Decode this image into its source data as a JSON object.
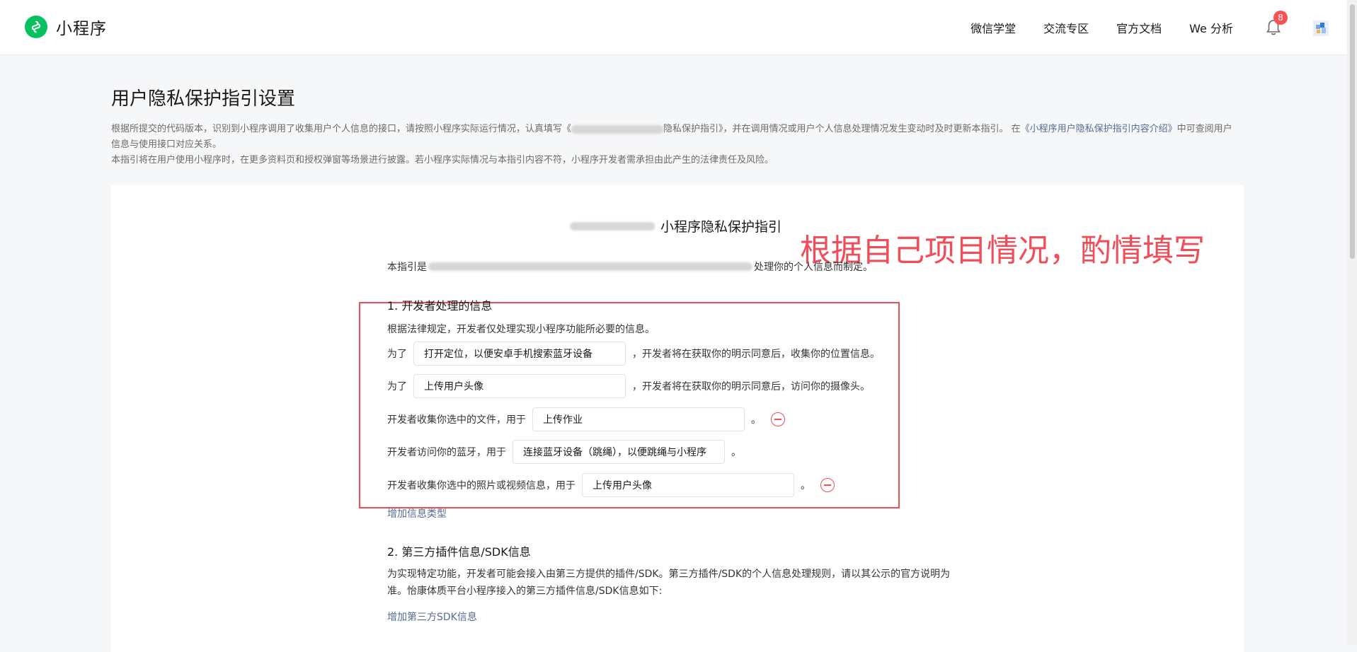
{
  "header": {
    "brand": "小程序",
    "nav": [
      "微信学堂",
      "交流专区",
      "官方文档",
      "We 分析"
    ],
    "notification_count": "8",
    "icons": [
      "mini-program-logo-icon",
      "bell-icon",
      "avatar"
    ]
  },
  "page": {
    "title": "用户隐私保护指引设置",
    "intro_1a": "根据所提交的代码版本，识别到小程序调用了收集用户个人信息的接口，请按照小程序实际运行情况，认真填写《",
    "intro_1b": "隐私保护指引》，并在调用情况或用户个人信息处理情况发生变动时及时更新本指引。 在",
    "intro_1_link": "《小程序用户隐私保护指引内容介绍》",
    "intro_1c": "中可查阅用户信息与使用接口对应关系。",
    "intro_2": "本指引将在用户使用小程序时，在更多资料页和授权弹窗等场景进行披露。若小程序实际情况与本指引内容不符，小程序开发者需承担由此产生的法律责任及风险。"
  },
  "document": {
    "title": "小程序隐私保护指引",
    "annotation": "根据自己项目情况，酌情填写",
    "lead_a": "本指引是",
    "lead_b": "处理你的个人信息而制定。",
    "section1_title": "1. 开发者处理的信息",
    "section1_desc": "根据法律规定，开发者仅处理实现小程序功能所必要的信息。",
    "rows": [
      {
        "prefix": "为了",
        "value": "打开定位，以便安卓手机搜索蓝牙设备",
        "suffix": "，开发者将在获取你的明示同意后，收集你的位置信息。"
      },
      {
        "prefix": "为了",
        "value": "上传用户头像",
        "suffix": "，开发者将在获取你的明示同意后，访问你的摄像头。"
      },
      {
        "prefix": "开发者收集你选中的文件，用于",
        "value": "上传作业",
        "suffix": "。"
      },
      {
        "prefix": "开发者访问你的蓝牙，用于",
        "value": "连接蓝牙设备（跳绳），以便跳绳与小程序",
        "suffix": "。"
      },
      {
        "prefix": "开发者收集你选中的照片或视频信息，用于",
        "value": "上传用户头像",
        "suffix": "。"
      }
    ],
    "add_info_type": "增加信息类型",
    "section2_title": "2. 第三方插件信息/SDK信息",
    "section2_desc": "为实现特定功能，开发者可能会接入由第三方提供的插件/SDK。第三方插件/SDK的个人信息处理规则，请以其公示的官方说明为准。怡康体质平台小程序接入的第三方插件信息/SDK信息如下:",
    "add_sdk": "增加第三方SDK信息"
  },
  "colors": {
    "accent": "#07c160",
    "annotation": "#f24c58",
    "link": "#576b95"
  }
}
